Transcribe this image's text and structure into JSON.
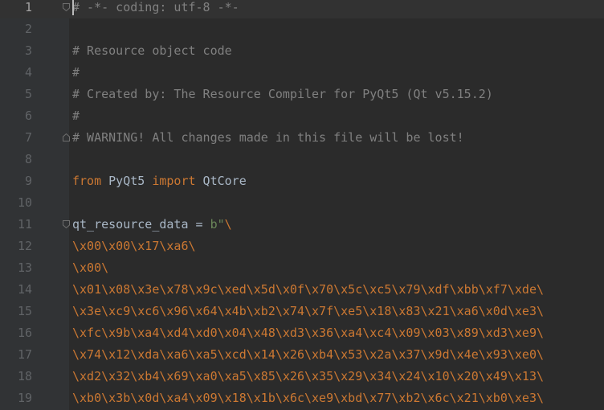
{
  "editor": {
    "current_line": 1,
    "lines": [
      {
        "number": "1",
        "text": "# -*- coding: utf-8 -*-"
      },
      {
        "number": "2",
        "text": ""
      },
      {
        "number": "3",
        "text": "# Resource object code"
      },
      {
        "number": "4",
        "text": "#"
      },
      {
        "number": "5",
        "text": "# Created by: The Resource Compiler for PyQt5 (Qt v5.15.2)"
      },
      {
        "number": "6",
        "text": "#"
      },
      {
        "number": "7",
        "text": "# WARNING! All changes made in this file will be lost!"
      },
      {
        "number": "8",
        "text": ""
      },
      {
        "number": "9",
        "kw1": "from",
        "mod": " PyQt5 ",
        "kw2": "import",
        "name": " QtCore"
      },
      {
        "number": "10",
        "text": ""
      },
      {
        "number": "11",
        "var": "qt_resource_data = ",
        "prefix": "b\"",
        "esc": "\\"
      },
      {
        "number": "12",
        "text": "\\x00\\x00\\x17\\xa6\\"
      },
      {
        "number": "13",
        "text": "\\x00\\"
      },
      {
        "number": "14",
        "text": "\\x01\\x08\\x3e\\x78\\x9c\\xed\\x5d\\x0f\\x70\\x5c\\xc5\\x79\\xdf\\xbb\\xf7\\xde\\"
      },
      {
        "number": "15",
        "text": "\\x3e\\xc9\\xc6\\x96\\x64\\x4b\\xb2\\x74\\x7f\\xe5\\x18\\x83\\x21\\xa6\\x0d\\xe3\\"
      },
      {
        "number": "16",
        "text": "\\xfc\\x9b\\xa4\\xd4\\xd0\\x04\\x48\\xd3\\x36\\xa4\\xc4\\x09\\x03\\x89\\xd3\\xe9\\"
      },
      {
        "number": "17",
        "text": "\\x74\\x12\\xda\\xa6\\xa5\\xcd\\x14\\x26\\xb4\\x53\\x2a\\x37\\x9d\\x4e\\x93\\xe0\\"
      },
      {
        "number": "18",
        "text": "\\xd2\\x32\\xb4\\x69\\xa0\\xa5\\x85\\x26\\x35\\x29\\x34\\x24\\x10\\x20\\x49\\x13\\"
      },
      {
        "number": "19",
        "text": "\\xb0\\x3b\\x0d\\xa4\\x09\\x18\\x1b\\x6c\\xe9\\xbd\\x77\\xb2\\x6c\\x21\\xb0\\xe3\\"
      }
    ]
  }
}
